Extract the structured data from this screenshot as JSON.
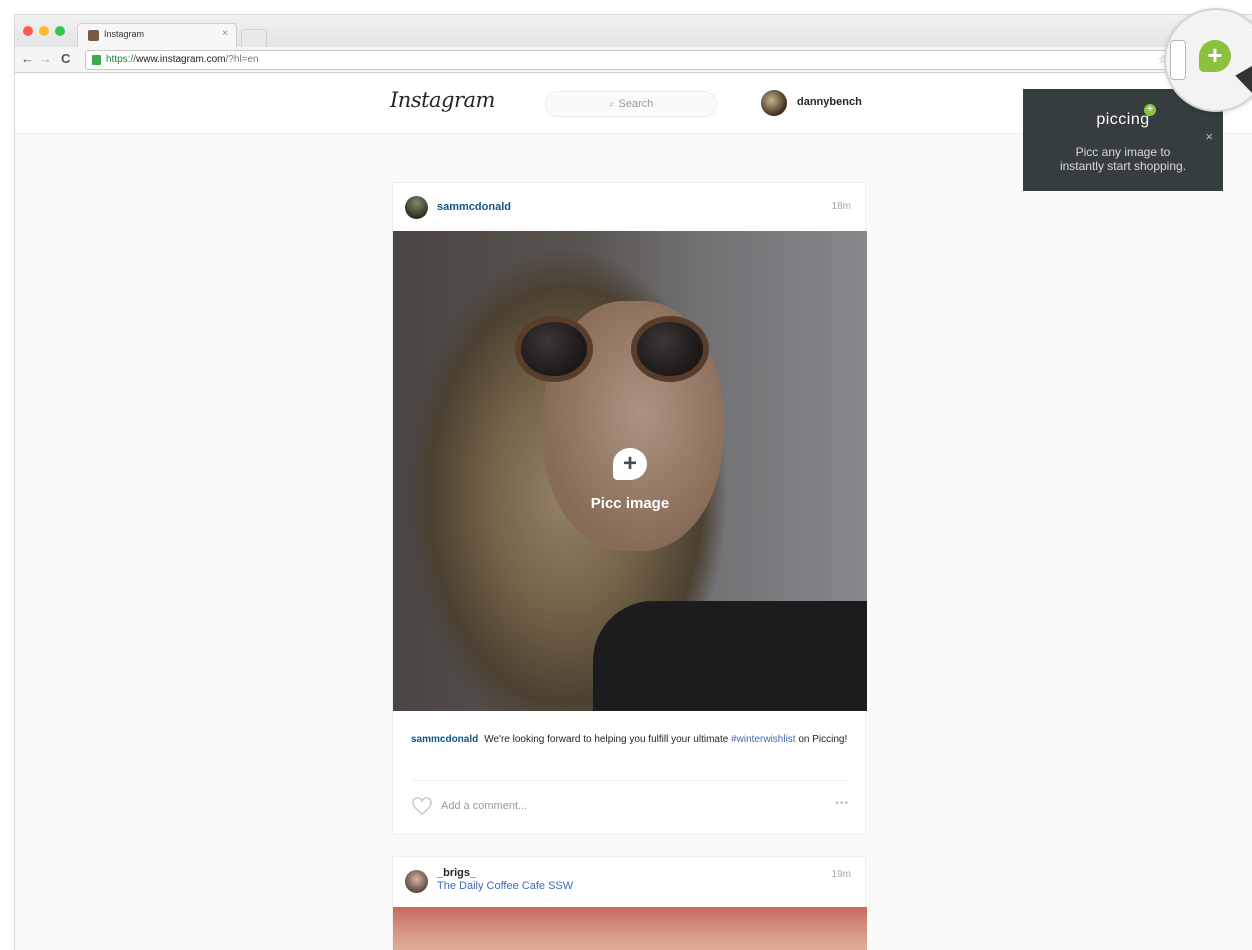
{
  "browser": {
    "tab_title": "Instagram",
    "tab_close": "×",
    "url_scheme": "https://",
    "url_host": "www.instagram.com",
    "url_rest": "/?hl=en"
  },
  "header": {
    "logo": "Instagram",
    "search_placeholder": "Search",
    "username": "dannybench"
  },
  "posts": [
    {
      "user": "sammcdonald",
      "time": "18m",
      "overlay_label": "Picc image",
      "caption_user": "sammcdonald",
      "caption_text": "We're looking forward to helping you fulfill your ultimate ",
      "caption_tag": "#winterwishlist",
      "caption_end": " on Piccing!",
      "comment_placeholder": "Add a comment...",
      "more": "•••"
    },
    {
      "user": "_brigs_",
      "location": "The Daily Coffee Cafe SSW",
      "time": "19m"
    }
  ],
  "picc_popup": {
    "logo": "piccing",
    "message_line1": "Picc any image to",
    "message_line2": "instantly start shopping.",
    "close": "×"
  },
  "colors": {
    "accent": "#8bc13f",
    "popup_bg": "#353d3f",
    "link": "#125688"
  }
}
